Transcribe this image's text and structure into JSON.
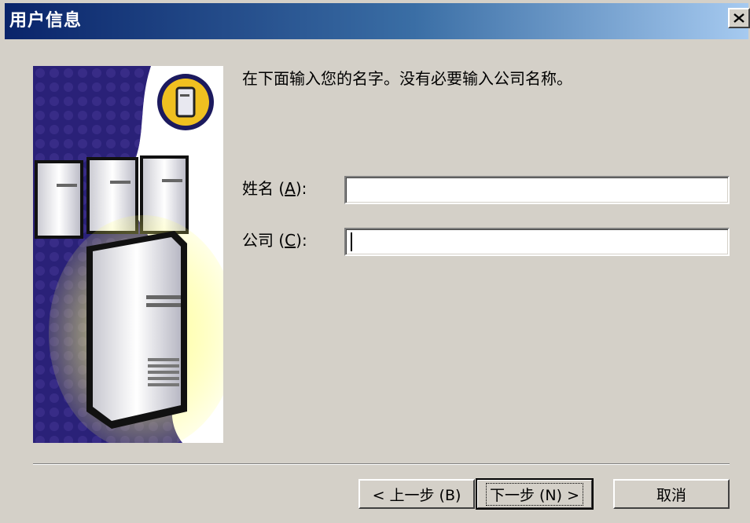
{
  "window": {
    "title": "用户信息",
    "close_symbol": "×"
  },
  "instruction": "在下面输入您的名字。没有必要输入公司名称。",
  "fields": {
    "name": {
      "label_prefix": "姓名 (",
      "mnemonic": "A",
      "label_suffix": "):",
      "value": ""
    },
    "company": {
      "label_prefix": "公司 (",
      "mnemonic": "C",
      "label_suffix": "):",
      "value": ""
    }
  },
  "buttons": {
    "back": "< 上一步 (B)",
    "next": "下一步 (N) >",
    "cancel": "取消"
  },
  "colors": {
    "titlebar_start": "#0a246a",
    "titlebar_end": "#a6caf0",
    "dialog_bg": "#d4d0c8"
  },
  "icons": {
    "side_image": "server-computers-illustration",
    "badge": "server-badge-icon",
    "close": "close-icon"
  }
}
